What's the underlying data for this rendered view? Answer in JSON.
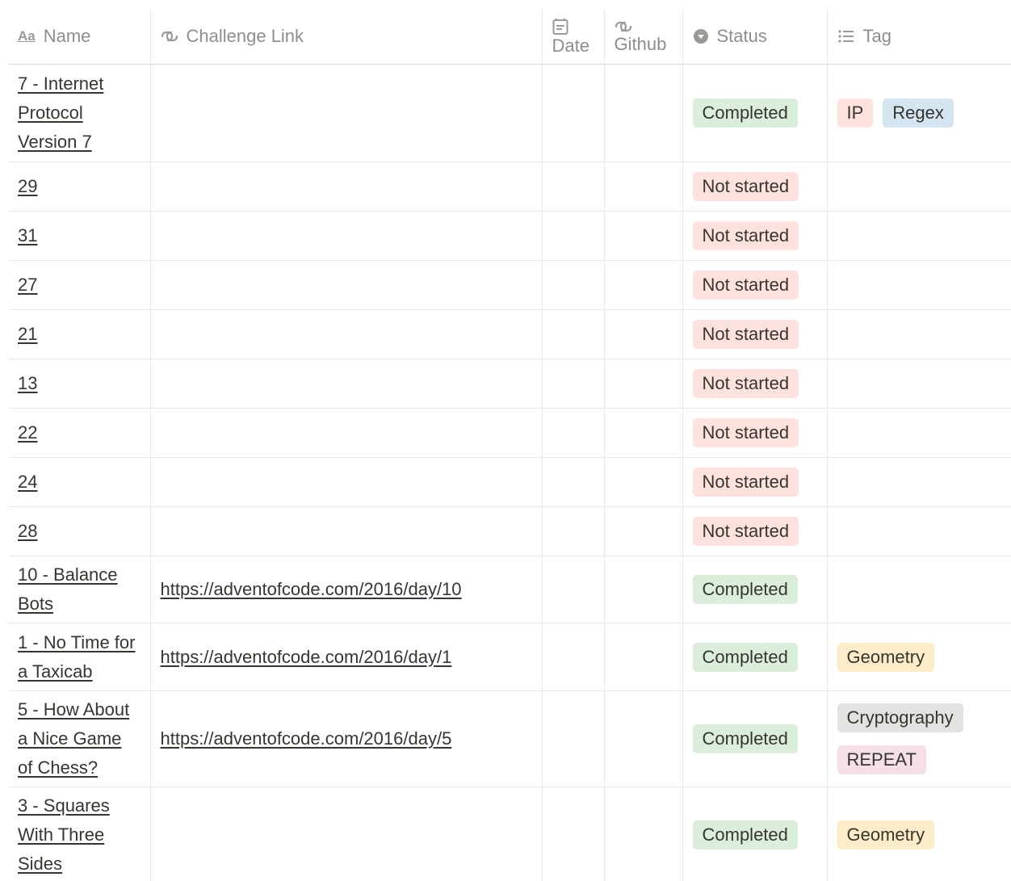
{
  "columns": {
    "name": {
      "label": "Name",
      "icon": "text-property-icon",
      "icon_glyph": "Aa"
    },
    "link": {
      "label": "Challenge Link",
      "icon": "url-property-icon"
    },
    "date": {
      "label": "Date",
      "icon": "calendar-icon"
    },
    "github": {
      "label": "Github",
      "icon": "url-property-icon"
    },
    "status": {
      "label": "Status",
      "icon": "status-icon"
    },
    "tag": {
      "label": "Tag",
      "icon": "list-icon"
    }
  },
  "colors": {
    "completed": "#dbeddb",
    "not_started": "#ffe2dd",
    "tag_ip": "#ffe2dd",
    "tag_regex": "#d3e5ef",
    "tag_geometry": "#fdecc8",
    "tag_cryptography": "#e3e2e0",
    "tag_repeat": "#f5e0e9"
  },
  "rows": [
    {
      "name": "7 - Internet Protocol Version 7",
      "link": "",
      "status": "Completed",
      "tags": [
        "IP",
        "Regex"
      ]
    },
    {
      "name": "29",
      "link": "",
      "status": "Not started",
      "tags": []
    },
    {
      "name": "31",
      "link": "",
      "status": "Not started",
      "tags": []
    },
    {
      "name": "27",
      "link": "",
      "status": "Not started",
      "tags": []
    },
    {
      "name": "21",
      "link": "",
      "status": "Not started",
      "tags": []
    },
    {
      "name": "13",
      "link": "",
      "status": "Not started",
      "tags": []
    },
    {
      "name": "22",
      "link": "",
      "status": "Not started",
      "tags": []
    },
    {
      "name": "24",
      "link": "",
      "status": "Not started",
      "tags": []
    },
    {
      "name": "28",
      "link": "",
      "status": "Not started",
      "tags": []
    },
    {
      "name": "10 - Balance Bots",
      "link": "https://adventofcode.com/2016/day/10",
      "status": "Completed",
      "tags": []
    },
    {
      "name": "1 - No Time for a Taxicab",
      "link": "https://adventofcode.com/2016/day/1",
      "status": "Completed",
      "tags": [
        "Geometry"
      ]
    },
    {
      "name": "5 - How About a Nice Game of Chess?",
      "link": "https://adventofcode.com/2016/day/5",
      "status": "Completed",
      "tags": [
        "Cryptography",
        "REPEAT"
      ]
    },
    {
      "name": "3 - Squares With Three Sides",
      "link": "",
      "status": "Completed",
      "tags": [
        "Geometry"
      ]
    }
  ]
}
